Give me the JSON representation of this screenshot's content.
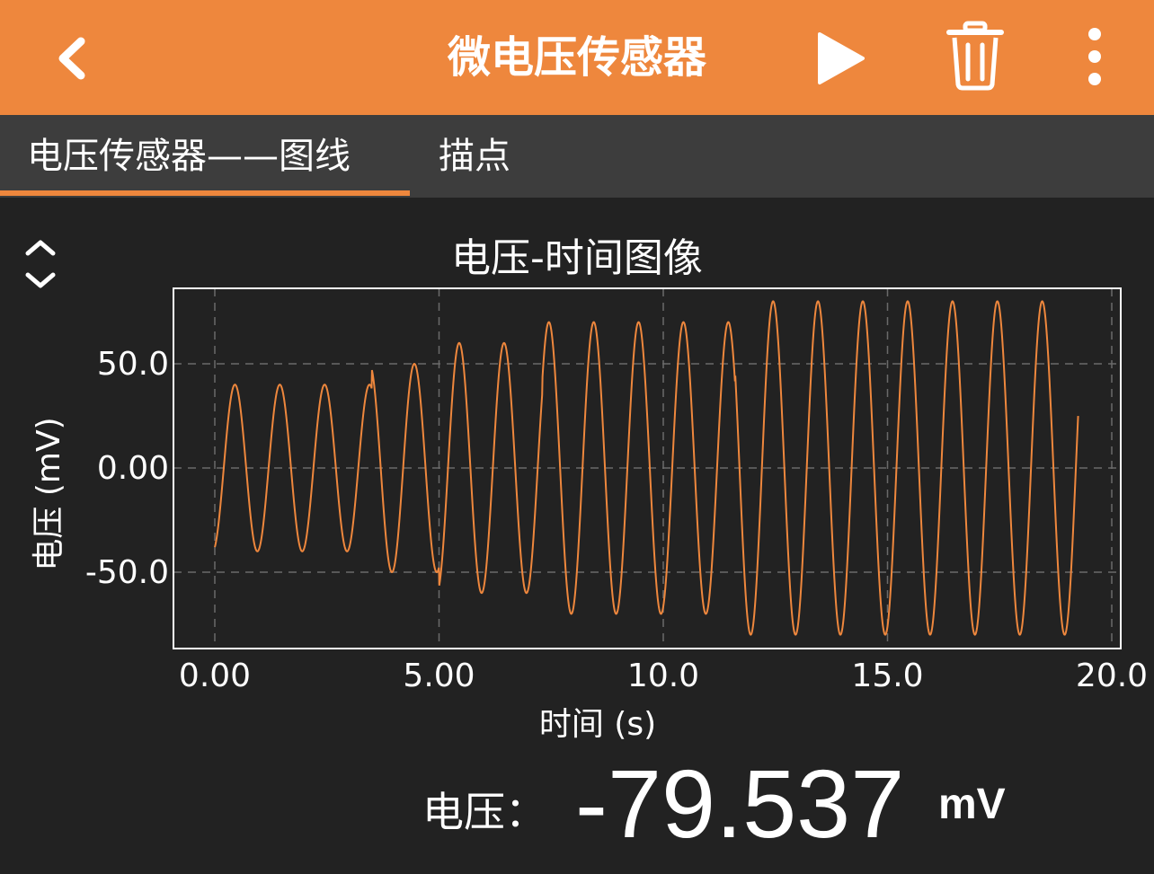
{
  "app_bar": {
    "title": "微电压传感器",
    "back_icon": "chevron-left-icon",
    "play_icon": "play-icon",
    "trash_icon": "trash-icon",
    "more_icon": "more-vertical-icon"
  },
  "tabs": [
    {
      "label": "电压传感器——图线",
      "active": true
    },
    {
      "label": "描点",
      "active": false
    }
  ],
  "colors": {
    "accent": "#ee873d",
    "background": "#222222",
    "tab_bar": "#3d3d3d",
    "series": "#ee873d"
  },
  "zoom_toggle_icon": "chevron-up-down-icon",
  "chart_data": {
    "type": "line",
    "title": "电压-时间图像",
    "xlabel": "时间 (s)",
    "ylabel": "电压 (mV)",
    "xlim": [
      0,
      20
    ],
    "ylim": [
      -80,
      80
    ],
    "xticks": [
      "0.00",
      "5.00",
      "10.0",
      "15.0",
      "20.0"
    ],
    "yticks": [
      "50.0",
      "0.00",
      "-50.0"
    ],
    "grid": true,
    "grid_style": "dashed",
    "segments": [
      {
        "t0": 0.0,
        "t1": 3.5,
        "period": 1.0,
        "amplitude": 40
      },
      {
        "t0": 3.5,
        "t1": 5.0,
        "period": 1.0,
        "amplitude": 50
      },
      {
        "t0": 5.0,
        "t1": 7.3,
        "period": 1.0,
        "amplitude": 60
      },
      {
        "t0": 7.3,
        "t1": 11.6,
        "period": 1.0,
        "amplitude": 70
      },
      {
        "t0": 11.6,
        "t1": 19.25,
        "period": 1.0,
        "amplitude": 80
      }
    ],
    "phase_start_value": -38,
    "end_time": 19.25
  },
  "reading": {
    "label": "电压：",
    "value": "-79.537",
    "unit": "mV"
  }
}
